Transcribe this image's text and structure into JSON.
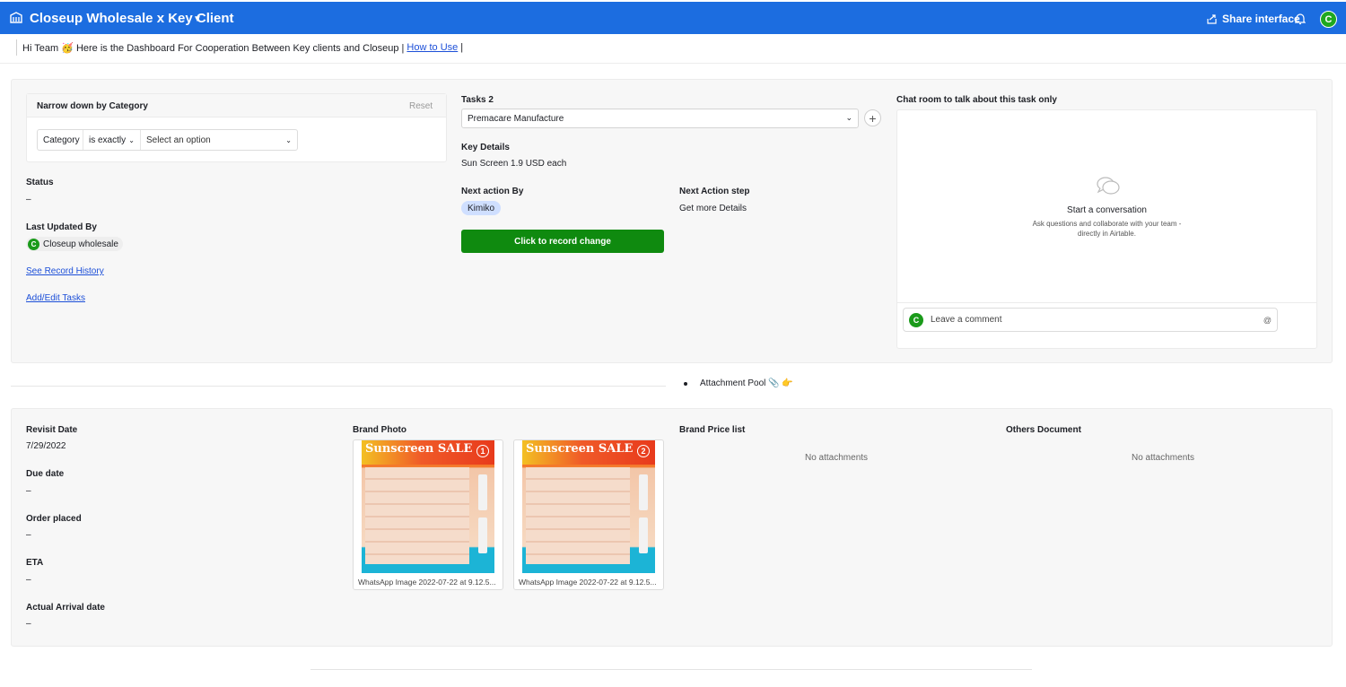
{
  "header": {
    "title": "Closeup Wholesale x Key Client",
    "share_label": "Share interface",
    "avatar_initial": "C",
    "colors": {
      "bar": "#1c6de0",
      "avatar": "#20a820"
    }
  },
  "banner": {
    "text_before": "Hi Team 🥳 Here is the Dashboard For Cooperation Between Key clients and Closeup |",
    "link": "How to Use",
    "text_after": "|"
  },
  "filter": {
    "title": "Narrow down by Category",
    "reset_label": "Reset",
    "field": "Category",
    "operator": "is exactly",
    "value_placeholder": "Select an option"
  },
  "left": {
    "status_label": "Status",
    "status_value": "–",
    "last_updated_label": "Last Updated By",
    "last_updated_user": "Closeup wholesale",
    "last_updated_initial": "C",
    "record_history_link": "See Record History",
    "add_edit_link": "Add/Edit Tasks"
  },
  "tasks": {
    "label": "Tasks 2",
    "selected": "Premacare Manufacture",
    "key_details_label": "Key Details",
    "key_details_value": "Sun Screen 1.9 USD each",
    "next_action_by_label": "Next action By",
    "next_action_by_value": "Kimiko",
    "next_action_step_label": "Next Action step",
    "next_action_step_value": "Get more Details",
    "record_button": "Click to record change",
    "colors": {
      "button": "#0f8a0f",
      "pill": "#cfdfff"
    }
  },
  "chat": {
    "label": "Chat room to talk about this task only",
    "title": "Start a conversation",
    "subtitle_line1": "Ask questions and collaborate with your team -",
    "subtitle_line2": "directly in Airtable.",
    "comment_placeholder": "Leave a comment",
    "avatar_initial": "C",
    "at_symbol": "@"
  },
  "pool": {
    "label": "Attachment Pool 📎 👉"
  },
  "dates": {
    "revisit_label": "Revisit Date",
    "revisit_value": "7/29/2022",
    "due_label": "Due date",
    "due_value": "–",
    "order_label": "Order placed",
    "order_value": "–",
    "eta_label": "ETA",
    "eta_value": "–",
    "arrival_label": "Actual Arrival date",
    "arrival_value": "–"
  },
  "attachments": {
    "brand_photo_label": "Brand Photo",
    "photos": [
      {
        "caption": "WhatsApp Image 2022-07-22 at 9.12.5...",
        "badge": "1"
      },
      {
        "caption": "WhatsApp Image 2022-07-22 at 9.12.5...",
        "badge": "2"
      }
    ],
    "photo_sale_text": "Sunscreen SALE",
    "price_list_label": "Brand Price list",
    "price_list_empty": "No attachments",
    "others_label": "Others Document",
    "others_empty": "No attachments"
  }
}
